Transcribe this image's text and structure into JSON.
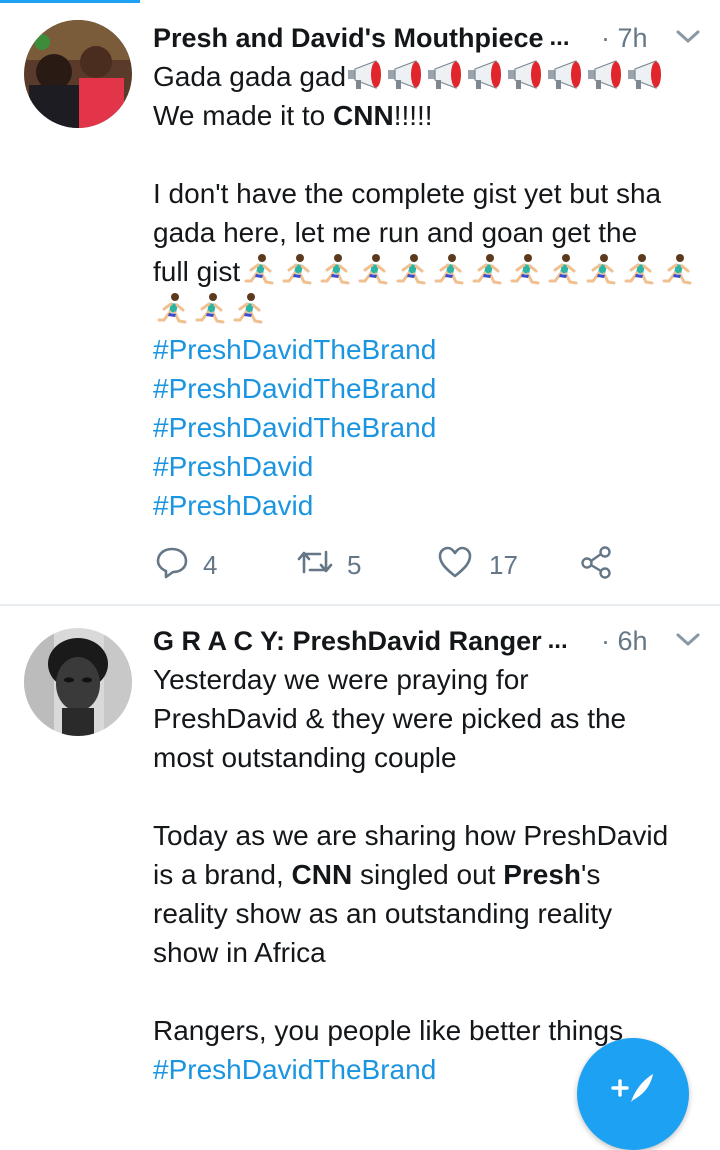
{
  "colors": {
    "accent": "#1da1f2",
    "link": "#1b95e0",
    "muted": "#657786"
  },
  "tweets": [
    {
      "author": "Presh and David's Mouthpiece",
      "ellipsis": "...",
      "time": "· 7h",
      "line1_text": "Gada gada gad",
      "megaphones": 8,
      "line2_pre": "We made it to ",
      "line2_bold": "CNN",
      "line2_post": "!!!!!",
      "line3": "I don't have the complete gist yet but sha",
      "line4": "gada here, let me run and goan get the",
      "line5_text": "full gist",
      "runners_line5": 12,
      "runners_line6": 3,
      "hashtags": [
        "#PreshDavidTheBrand",
        "#PreshDavidTheBrand",
        "#PreshDavidTheBrand",
        "#PreshDavid",
        "#PreshDavid"
      ],
      "reply_count": "4",
      "retweet_count": "5",
      "like_count": "17"
    },
    {
      "author": "G R A C Y: PreshDavid Ranger",
      "ellipsis": "...",
      "time": "· 6h",
      "p1": [
        "Yesterday we were praying for",
        "PreshDavid & they were picked as the",
        "most outstanding couple"
      ],
      "p2_l1": "Today as we are sharing how PreshDavid",
      "p2_l2_pre": "is a brand, ",
      "p2_l2_b1": "CNN",
      "p2_l2_mid": " singled out ",
      "p2_l2_b2": "Presh",
      "p2_l2_post": "'s",
      "p2_l3": "reality show as an outstanding reality",
      "p2_l4": "show in Africa",
      "p3": "Rangers, you people like better things",
      "hashtag": "#PreshDavidTheBrand"
    }
  ],
  "icons": [
    "reply-icon",
    "retweet-icon",
    "like-icon",
    "share-icon",
    "chevron-down-icon",
    "compose-icon",
    "megaphone-emoji",
    "running-man-emoji"
  ]
}
